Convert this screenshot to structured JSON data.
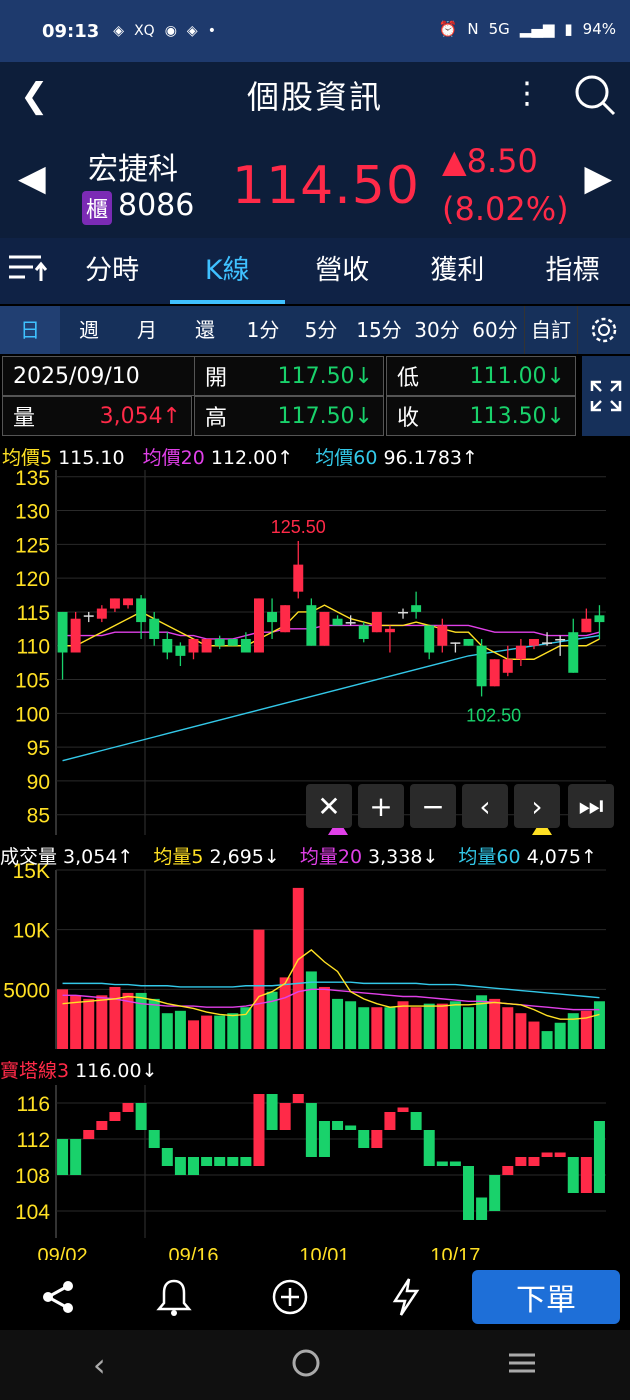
{
  "status": {
    "time": "09:13",
    "battery": "94%",
    "network": "5G",
    "icons": [
      "app-icon",
      "xq-icon",
      "line-icon",
      "app-icon",
      "dot-icon"
    ]
  },
  "header": {
    "title": "個股資訊"
  },
  "stock": {
    "name": "宏捷科",
    "badge": "櫃",
    "code": "8086",
    "price": "114.50",
    "change": "8.50",
    "change_pct": "(8.02%)"
  },
  "tabs": [
    "分時",
    "K線",
    "營收",
    "獲利",
    "指標"
  ],
  "active_tab": "K線",
  "periods": [
    "日",
    "週",
    "月",
    "還",
    "1分",
    "5分",
    "15分",
    "30分",
    "60分",
    "自訂"
  ],
  "active_period": "日",
  "ohlc": {
    "date": "2025/09/10",
    "open_label": "開",
    "open": "117.50↓",
    "low_label": "低",
    "low": "111.00↓",
    "vol_label": "量",
    "vol": "3,054↑",
    "high_label": "高",
    "high": "117.50↓",
    "close_label": "收",
    "close": "113.50↓"
  },
  "ma_legend": {
    "ma5_label": "均價5",
    "ma5": "115.10",
    "ma20_label": "均價20",
    "ma20": "112.00↑",
    "ma60_label": "均價60",
    "ma60": "96.1783↑"
  },
  "vol_legend": {
    "vol_label": "成交量",
    "vol": "3,054↑",
    "v5_label": "均量5",
    "v5": "2,695↓",
    "v20_label": "均量20",
    "v20": "3,338↓",
    "v60_label": "均量60",
    "v60": "4,075↑"
  },
  "tower_legend": {
    "label": "寶塔線3",
    "value": "116.00↓"
  },
  "chart_data": {
    "type": "candlestick",
    "price_axis": {
      "ticks": [
        135,
        130,
        125,
        120,
        115,
        110,
        105,
        100,
        95,
        90,
        85
      ],
      "ylim": [
        82,
        136
      ]
    },
    "volume_axis": {
      "ticks": [
        "15K",
        "10K",
        "5000"
      ],
      "ylim": [
        0,
        15000
      ]
    },
    "tower_axis": {
      "ticks": [
        116,
        112,
        108,
        104
      ],
      "ylim": [
        101,
        118
      ]
    },
    "x_labels": [
      "09/02",
      "09/16",
      "10/01",
      "10/17"
    ],
    "annotations": [
      "125.50",
      "102.50"
    ],
    "candles": [
      {
        "o": 115,
        "h": 115,
        "c": 109,
        "l": 105
      },
      {
        "o": 109,
        "h": 115,
        "c": 114,
        "l": 109
      },
      {
        "o": 114.5,
        "h": 115,
        "c": 114.5,
        "l": 113.5
      },
      {
        "o": 114,
        "h": 116,
        "c": 115.5,
        "l": 113.5
      },
      {
        "o": 115.5,
        "h": 117,
        "c": 117,
        "l": 115
      },
      {
        "o": 116,
        "h": 117,
        "c": 117,
        "l": 115.5
      },
      {
        "o": 117,
        "h": 117.5,
        "c": 113.5,
        "l": 111
      },
      {
        "o": 114,
        "h": 115,
        "c": 111,
        "l": 110
      },
      {
        "o": 111,
        "h": 112,
        "c": 109,
        "l": 108
      },
      {
        "o": 110,
        "h": 110.5,
        "c": 108.5,
        "l": 107
      },
      {
        "o": 109,
        "h": 111,
        "c": 111,
        "l": 108
      },
      {
        "o": 109,
        "h": 111,
        "c": 111,
        "l": 109
      },
      {
        "o": 111,
        "h": 111.5,
        "c": 110,
        "l": 109.5
      },
      {
        "o": 111,
        "h": 111,
        "c": 110,
        "l": 110
      },
      {
        "o": 111,
        "h": 112,
        "c": 109,
        "l": 109
      },
      {
        "o": 109,
        "h": 117,
        "c": 117,
        "l": 109
      },
      {
        "o": 115,
        "h": 117,
        "c": 113.5,
        "l": 111
      },
      {
        "o": 112,
        "h": 116,
        "c": 116,
        "l": 112
      },
      {
        "o": 118,
        "h": 125.5,
        "c": 122,
        "l": 117
      },
      {
        "o": 116,
        "h": 117,
        "c": 110,
        "l": 110
      },
      {
        "o": 110,
        "h": 115,
        "c": 115,
        "l": 110
      },
      {
        "o": 114,
        "h": 114.5,
        "c": 113,
        "l": 113
      },
      {
        "o": 113.5,
        "h": 114.5,
        "c": 113.5,
        "l": 113
      },
      {
        "o": 113,
        "h": 113.5,
        "c": 111,
        "l": 110.5
      },
      {
        "o": 112,
        "h": 115,
        "c": 115,
        "l": 112
      },
      {
        "o": 112,
        "h": 113,
        "c": 112.5,
        "l": 109
      },
      {
        "o": 115,
        "h": 115.5,
        "c": 115,
        "l": 114
      },
      {
        "o": 116,
        "h": 118,
        "c": 115,
        "l": 114
      },
      {
        "o": 113,
        "h": 113,
        "c": 109,
        "l": 108
      },
      {
        "o": 110,
        "h": 114,
        "c": 113,
        "l": 109
      },
      {
        "o": 110.5,
        "h": 110.5,
        "c": 110.5,
        "l": 109
      },
      {
        "o": 111,
        "h": 111,
        "c": 110,
        "l": 110
      },
      {
        "o": 110,
        "h": 111,
        "c": 104,
        "l": 102.5
      },
      {
        "o": 104,
        "h": 108,
        "c": 108,
        "l": 104
      },
      {
        "o": 106,
        "h": 110,
        "c": 108,
        "l": 105.5
      },
      {
        "o": 108,
        "h": 111,
        "c": 110,
        "l": 107
      },
      {
        "o": 110,
        "h": 110,
        "c": 111,
        "l": 109.5
      },
      {
        "o": 110.5,
        "h": 112,
        "c": 110.5,
        "l": 110
      },
      {
        "o": 111,
        "h": 111.5,
        "c": 111,
        "l": 108.5
      },
      {
        "o": 112,
        "h": 114,
        "c": 106,
        "l": 106
      },
      {
        "o": 112,
        "h": 115.5,
        "c": 114,
        "l": 112
      },
      {
        "o": 114.5,
        "h": 116,
        "c": 113.5,
        "l": 111
      }
    ],
    "ma5": [
      110,
      110,
      111,
      112,
      113,
      114,
      115,
      114,
      113,
      112,
      111,
      110,
      110,
      110,
      110,
      111,
      112,
      113,
      115,
      115,
      116,
      115,
      114,
      113.5,
      113,
      113,
      113,
      113.5,
      113,
      112.5,
      112,
      112,
      110,
      109,
      108,
      108,
      108,
      109,
      110,
      110,
      110,
      111
    ],
    "ma20": [
      111.5,
      111.5,
      111.5,
      111.5,
      112,
      112,
      112,
      112,
      112,
      111.5,
      111.5,
      111,
      111,
      111,
      111.5,
      112,
      112,
      112.5,
      112.5,
      112.5,
      113,
      113,
      113,
      113,
      113,
      113,
      113,
      113,
      113,
      113,
      113,
      113,
      112.5,
      112,
      112,
      112,
      112,
      111.5,
      111.5,
      111.5,
      111.5,
      112
    ],
    "ma60": [
      93,
      93.5,
      94,
      94.5,
      95,
      95.5,
      96,
      96.5,
      97,
      97.5,
      98,
      98.5,
      99,
      99.5,
      100,
      100.5,
      101,
      101.5,
      102,
      102.5,
      103,
      103.5,
      104,
      104.5,
      105,
      105.5,
      106,
      106.5,
      107,
      107.5,
      108,
      108.5,
      108.8,
      109.1,
      109.4,
      109.7,
      110,
      110.3,
      110.6,
      110.9,
      111.2,
      111.5
    ],
    "volume": [
      5000,
      4500,
      4200,
      4500,
      5200,
      4700,
      4700,
      4200,
      3000,
      3200,
      2400,
      2800,
      2800,
      3000,
      3500,
      10000,
      4800,
      6000,
      13500,
      6500,
      5200,
      4200,
      4000,
      3500,
      3500,
      3500,
      4000,
      3500,
      3800,
      3800,
      4000,
      3500,
      4500,
      4200,
      3500,
      3000,
      2300,
      1500,
      2200,
      3000,
      3200,
      4000
    ],
    "vol_up": [
      true,
      true,
      true,
      true,
      true,
      true,
      false,
      false,
      false,
      false,
      true,
      true,
      false,
      false,
      false,
      true,
      false,
      true,
      true,
      false,
      true,
      false,
      false,
      false,
      true,
      false,
      true,
      true,
      false,
      true,
      false,
      false,
      false,
      true,
      true,
      true,
      true,
      false,
      false,
      false,
      true,
      false
    ],
    "v5": [
      3800,
      3900,
      4000,
      4100,
      4200,
      4400,
      4300,
      4100,
      3800,
      3600,
      3400,
      3100,
      2900,
      2800,
      2900,
      4400,
      4800,
      5500,
      7500,
      8300,
      7300,
      6500,
      4800,
      4200,
      3800,
      3500,
      3600,
      3600,
      3600,
      3600,
      3700,
      3700,
      3800,
      3900,
      3800,
      3700,
      3300,
      2800,
      2500,
      2500,
      2600,
      2900
    ],
    "v20": [
      4500,
      4500,
      4400,
      4300,
      4200,
      4000,
      3800,
      3700,
      3600,
      3600,
      3600,
      3500,
      3500,
      3500,
      3600,
      3800,
      4000,
      4300,
      4800,
      5000,
      5000,
      4900,
      4800,
      4700,
      4600,
      4500,
      4400,
      4400,
      4300,
      4200,
      4100,
      4000,
      4000,
      3900,
      3800,
      3700,
      3600,
      3500,
      3400,
      3300,
      3300,
      3300
    ],
    "v60": [
      5500,
      5500,
      5500,
      5500,
      5400,
      5400,
      5300,
      5300,
      5300,
      5200,
      5200,
      5200,
      5200,
      5200,
      5300,
      5300,
      5300,
      5400,
      5500,
      5600,
      5600,
      5600,
      5600,
      5500,
      5500,
      5500,
      5500,
      5500,
      5400,
      5400,
      5400,
      5300,
      5200,
      5100,
      5000,
      4900,
      4800,
      4700,
      4600,
      4500,
      4400,
      4300
    ],
    "tower": [
      {
        "a": 108,
        "b": 112,
        "up": false
      },
      {
        "a": 108,
        "b": 112,
        "up": false
      },
      {
        "a": 112,
        "b": 113,
        "up": true
      },
      {
        "a": 113,
        "b": 114,
        "up": true
      },
      {
        "a": 114,
        "b": 115,
        "up": true
      },
      {
        "a": 115,
        "b": 116,
        "up": true
      },
      {
        "a": 113,
        "b": 116,
        "up": false
      },
      {
        "a": 111,
        "b": 113,
        "up": false
      },
      {
        "a": 109,
        "b": 111,
        "up": false
      },
      {
        "a": 108,
        "b": 110,
        "up": false
      },
      {
        "a": 108,
        "b": 110,
        "up": false
      },
      {
        "a": 109,
        "b": 110,
        "up": false
      },
      {
        "a": 109,
        "b": 110,
        "up": false
      },
      {
        "a": 109,
        "b": 110,
        "up": false
      },
      {
        "a": 109,
        "b": 110,
        "up": false
      },
      {
        "a": 109,
        "b": 117,
        "up": true
      },
      {
        "a": 113,
        "b": 117,
        "up": false
      },
      {
        "a": 113,
        "b": 116,
        "up": true
      },
      {
        "a": 116,
        "b": 117,
        "up": true
      },
      {
        "a": 110,
        "b": 116,
        "up": false
      },
      {
        "a": 110,
        "b": 114,
        "up": false
      },
      {
        "a": 113,
        "b": 114,
        "up": false
      },
      {
        "a": 113,
        "b": 113.5,
        "up": false
      },
      {
        "a": 111,
        "b": 113,
        "up": false
      },
      {
        "a": 111,
        "b": 113,
        "up": true
      },
      {
        "a": 113,
        "b": 115,
        "up": true
      },
      {
        "a": 115,
        "b": 115.5,
        "up": true
      },
      {
        "a": 113,
        "b": 115,
        "up": false
      },
      {
        "a": 109,
        "b": 113,
        "up": false
      },
      {
        "a": 109,
        "b": 109.5,
        "up": false
      },
      {
        "a": 109,
        "b": 109.5,
        "up": false
      },
      {
        "a": 103,
        "b": 109,
        "up": false
      },
      {
        "a": 103,
        "b": 105.5,
        "up": false
      },
      {
        "a": 104,
        "b": 108,
        "up": false
      },
      {
        "a": 108,
        "b": 109,
        "up": true
      },
      {
        "a": 109,
        "b": 110,
        "up": true
      },
      {
        "a": 109,
        "b": 110,
        "up": true
      },
      {
        "a": 110,
        "b": 110.5,
        "up": true
      },
      {
        "a": 110,
        "b": 110.5,
        "up": true
      },
      {
        "a": 106,
        "b": 110,
        "up": false
      },
      {
        "a": 106,
        "b": 110,
        "up": true
      },
      {
        "a": 106,
        "b": 114,
        "up": false
      }
    ]
  },
  "bottom_nav": [
    "share-icon",
    "bell-icon",
    "add-circle-icon",
    "lightning-icon"
  ],
  "order_button": "下單"
}
